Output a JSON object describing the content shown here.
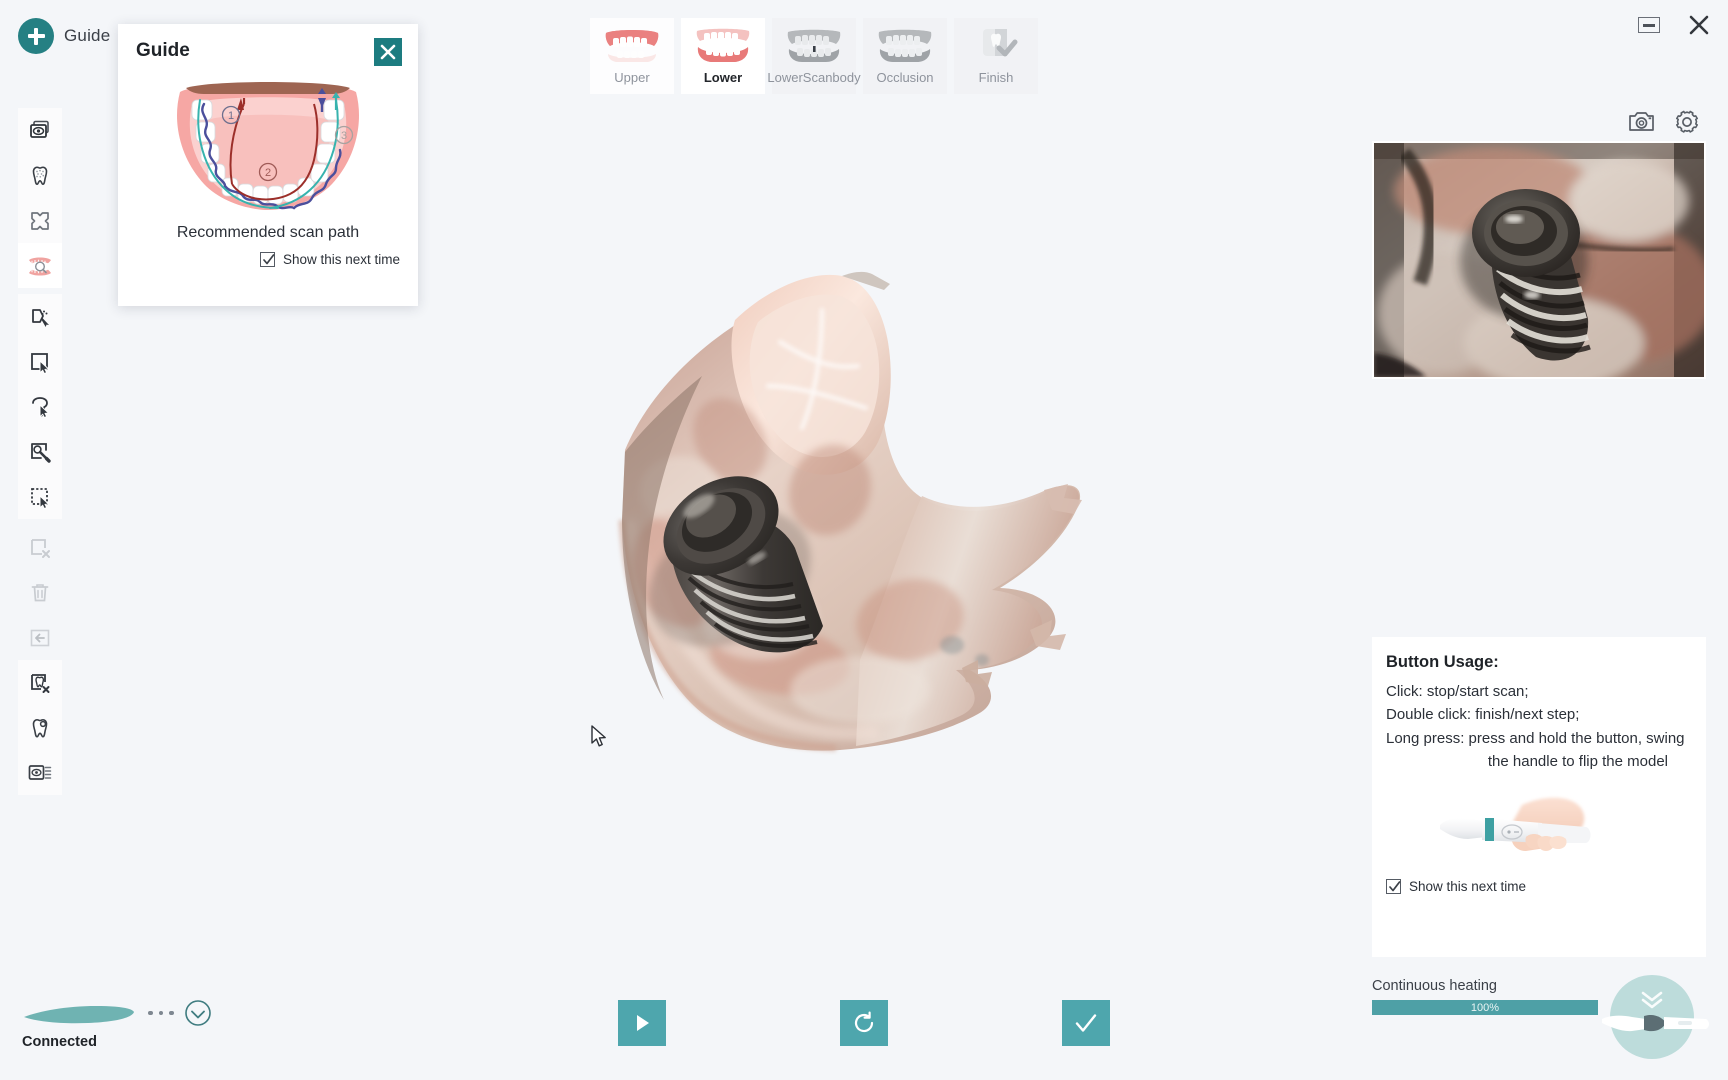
{
  "window": {
    "minimize_label": "Minimize",
    "close_label": "Close"
  },
  "guide_launcher": {
    "label": "Guide",
    "icon": "plus-icon",
    "accent": "#258083"
  },
  "toolbar": {
    "items": [
      {
        "name": "multi-view-eye-icon",
        "label": "Multi view",
        "state": "enabled"
      },
      {
        "name": "tooth-texture-icon",
        "label": "Texture",
        "state": "enabled"
      },
      {
        "name": "expand-icon",
        "label": "Fit view",
        "state": "enabled"
      },
      {
        "name": "arch-inspect-icon",
        "label": "Arch inspect",
        "state": "selected"
      },
      {
        "name": "trim-cut-icon",
        "label": "Trim",
        "state": "enabled"
      },
      {
        "name": "rect-select-icon",
        "label": "Rectangle select",
        "state": "enabled"
      },
      {
        "name": "lasso-select-icon",
        "label": "Lasso select",
        "state": "enabled"
      },
      {
        "name": "brush-select-icon",
        "label": "Brush select",
        "state": "enabled"
      },
      {
        "name": "marquee-select-icon",
        "label": "Marquee select",
        "state": "enabled"
      },
      {
        "name": "deselect-icon",
        "label": "Deselect",
        "state": "disabled"
      },
      {
        "name": "trash-icon",
        "label": "Delete",
        "state": "disabled"
      },
      {
        "name": "undo-icon",
        "label": "Undo",
        "state": "disabled"
      },
      {
        "name": "remove-tooth-icon",
        "label": "Remove tooth",
        "state": "enabled"
      },
      {
        "name": "tooth-hole-icon",
        "label": "Fill hole",
        "state": "enabled"
      },
      {
        "name": "scan-compare-icon",
        "label": "Compare scan",
        "state": "enabled"
      }
    ]
  },
  "tabs": [
    {
      "label": "Upper",
      "icon": "upper-arch-icon",
      "state": "inactive-light"
    },
    {
      "label": "Lower",
      "icon": "lower-arch-icon",
      "state": "active"
    },
    {
      "label": "LowerScanbody",
      "icon": "scanbody-arch-icon",
      "state": "inactive"
    },
    {
      "label": "Occlusion",
      "icon": "occlusion-arch-icon",
      "state": "inactive"
    },
    {
      "label": "Finish",
      "icon": "finish-check-icon",
      "state": "inactive"
    }
  ],
  "guide_dialog": {
    "title": "Guide",
    "caption": "Recommended scan path",
    "show_next_time_label": "Show this next time",
    "show_next_time_checked": true,
    "close_icon": "close-icon",
    "path_markers": [
      "1",
      "2",
      "3"
    ]
  },
  "right_panel": {
    "camera_icon": "camera-icon",
    "settings_icon": "gear-icon",
    "preview_alt": "live intraoral camera preview of implant scanbody"
  },
  "button_usage": {
    "title": "Button Usage:",
    "lines": [
      "Click: stop/start scan;",
      "Double click: finish/next step;",
      "Long press: press and hold the button, swing"
    ],
    "line_indent": "the handle to flip the model",
    "show_next_time_label": "Show this next time",
    "show_next_time_checked": true
  },
  "heating": {
    "label": "Continuous heating",
    "percent_text": "100%",
    "percent_value": 100,
    "bar_color": "#4ea0a6"
  },
  "bottom_controls": [
    {
      "name": "play-scan-button",
      "icon": "play-icon",
      "label": "Start scan"
    },
    {
      "name": "reset-view-button",
      "icon": "rotate-ccw-icon",
      "label": "Reset"
    },
    {
      "name": "confirm-button",
      "icon": "check-icon",
      "label": "Confirm"
    }
  ],
  "status": {
    "text": "Connected",
    "device_icon": "scanner-wand-icon",
    "check_icon": "circle-check-icon",
    "accent": "#6fb3b2"
  },
  "theme": {
    "accent_teal": "#4ea6ad",
    "deep_teal": "#1d7c80",
    "background": "#f4f6f9",
    "panel": "#ffffff"
  }
}
